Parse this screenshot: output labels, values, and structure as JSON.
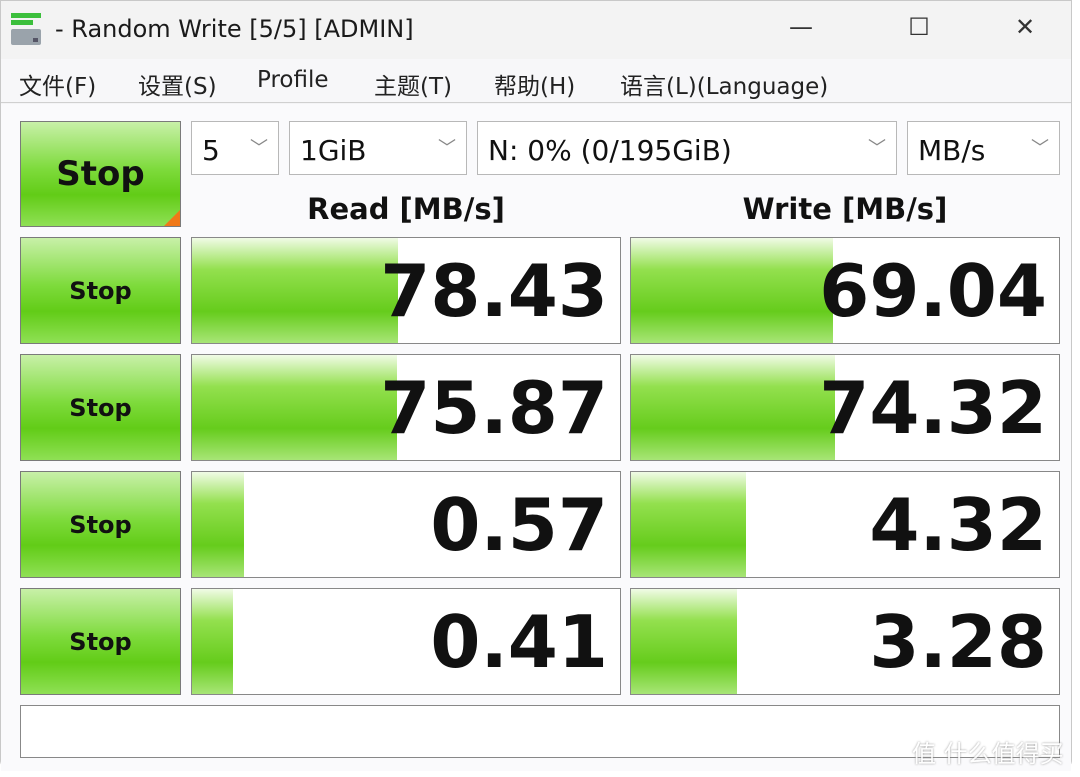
{
  "window": {
    "title": "- Random Write [5/5] [ADMIN]",
    "minimize": "—",
    "maximize": "☐",
    "close": "✕"
  },
  "menu": [
    "文件(F)",
    "设置(S)",
    "Profile",
    "主题(T)",
    "帮助(H)",
    "语言(L)(Language)"
  ],
  "controls": {
    "stop_all": "Stop",
    "count": "5",
    "size": "1GiB",
    "drive": "N: 0% (0/195GiB)",
    "unit": "MB/s"
  },
  "headers": {
    "read": "Read [MB/s]",
    "write": "Write [MB/s]"
  },
  "rows": [
    {
      "button": "Stop",
      "read": "78.43",
      "write": "69.04"
    },
    {
      "button": "Stop",
      "read": "75.87",
      "write": "74.32"
    },
    {
      "button": "Stop",
      "read": "0.57",
      "write": "4.32"
    },
    {
      "button": "Stop",
      "read": "0.41",
      "write": "3.28"
    }
  ],
  "message": "",
  "watermark": "值 什么值得买",
  "colors": {
    "bar": "#66cc1c",
    "corner": "#f07818"
  }
}
